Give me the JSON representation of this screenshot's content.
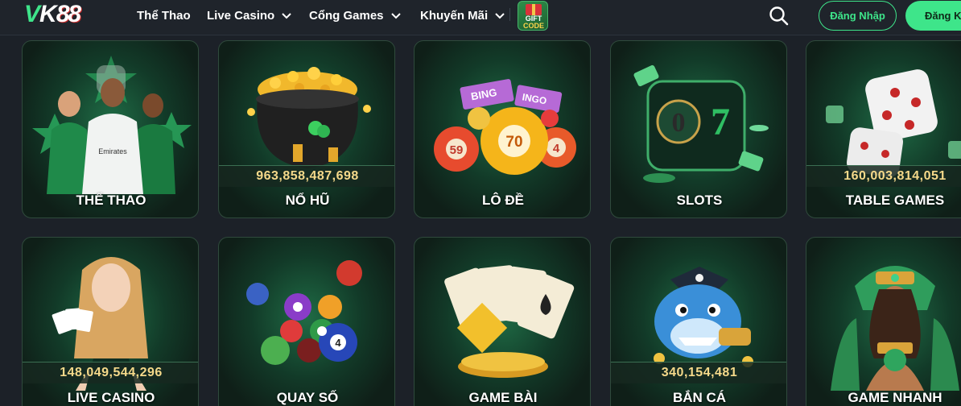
{
  "header": {
    "logo": {
      "text_v": "V",
      "text_k": "K",
      "text_num": "88"
    },
    "nav": [
      {
        "label": "Thể Thao",
        "has_dropdown": false
      },
      {
        "label": "Live Casino",
        "has_dropdown": true
      },
      {
        "label": "Cổng Games",
        "has_dropdown": true
      },
      {
        "label": "Khuyến Mãi",
        "has_dropdown": true
      }
    ],
    "giftcode": {
      "line1": "GIFT",
      "line2": "CODE"
    },
    "search_icon": "search-icon",
    "login_label": "Đăng Nhập",
    "register_label": "Đăng Ký"
  },
  "cards": [
    {
      "title": "THỂ THAO",
      "jackpot": null,
      "art": "football-players"
    },
    {
      "title": "NỔ HŨ",
      "jackpot": "963,858,487,698",
      "art": "gold-pot"
    },
    {
      "title": "LÔ ĐỀ",
      "jackpot": null,
      "art": "lottery-balls"
    },
    {
      "title": "SLOTS",
      "jackpot": null,
      "art": "slot-machine"
    },
    {
      "title": "TABLE GAMES",
      "jackpot": "160,003,814,051",
      "art": "dice"
    },
    {
      "title": "LIVE CASINO",
      "jackpot": "148,049,544,296",
      "art": "dealer"
    },
    {
      "title": "QUAY SỐ",
      "jackpot": null,
      "art": "billiard-balls"
    },
    {
      "title": "GAME BÀI",
      "jackpot": null,
      "art": "playing-cards"
    },
    {
      "title": "BẮN CÁ",
      "jackpot": "340,154,481",
      "art": "shark"
    },
    {
      "title": "GAME NHANH",
      "jackpot": null,
      "art": "aztec-girl"
    }
  ],
  "colors": {
    "accent": "#3ee58a",
    "background": "#1c2128",
    "jackpot_text": "#f5d98a"
  }
}
